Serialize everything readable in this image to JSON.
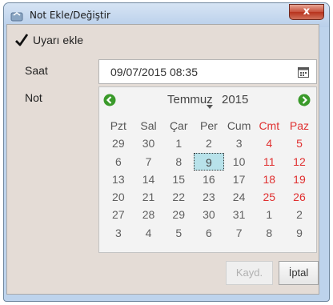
{
  "window": {
    "title": "Not Ekle/Değiştir",
    "close_label": "x"
  },
  "form": {
    "alarm_checkbox": {
      "label": "Uyarı ekle",
      "checked": true
    },
    "time_label": "Saat",
    "time_value": "09/07/2015 08:35",
    "note_label": "Not"
  },
  "calendar": {
    "month": "Temmuz",
    "year": "2015",
    "weekdays": [
      "Pzt",
      "Sal",
      "Çar",
      "Per",
      "Cum",
      "Cmt",
      "Paz"
    ],
    "weeks": [
      [
        "29",
        "30",
        "1",
        "2",
        "3",
        "4",
        "5"
      ],
      [
        "6",
        "7",
        "8",
        "9",
        "10",
        "11",
        "12"
      ],
      [
        "13",
        "14",
        "15",
        "16",
        "17",
        "18",
        "19"
      ],
      [
        "20",
        "21",
        "22",
        "23",
        "24",
        "25",
        "26"
      ],
      [
        "27",
        "28",
        "29",
        "30",
        "31",
        "1",
        "2"
      ],
      [
        "3",
        "4",
        "5",
        "6",
        "7",
        "8",
        "9"
      ]
    ],
    "selected_day": "9",
    "weekend_color": "#e03030",
    "selected_color": "#b8e2ea",
    "nav_color": "#3a9a2a"
  },
  "buttons": {
    "save_label": "Kayd.",
    "cancel_label": "İptal"
  }
}
